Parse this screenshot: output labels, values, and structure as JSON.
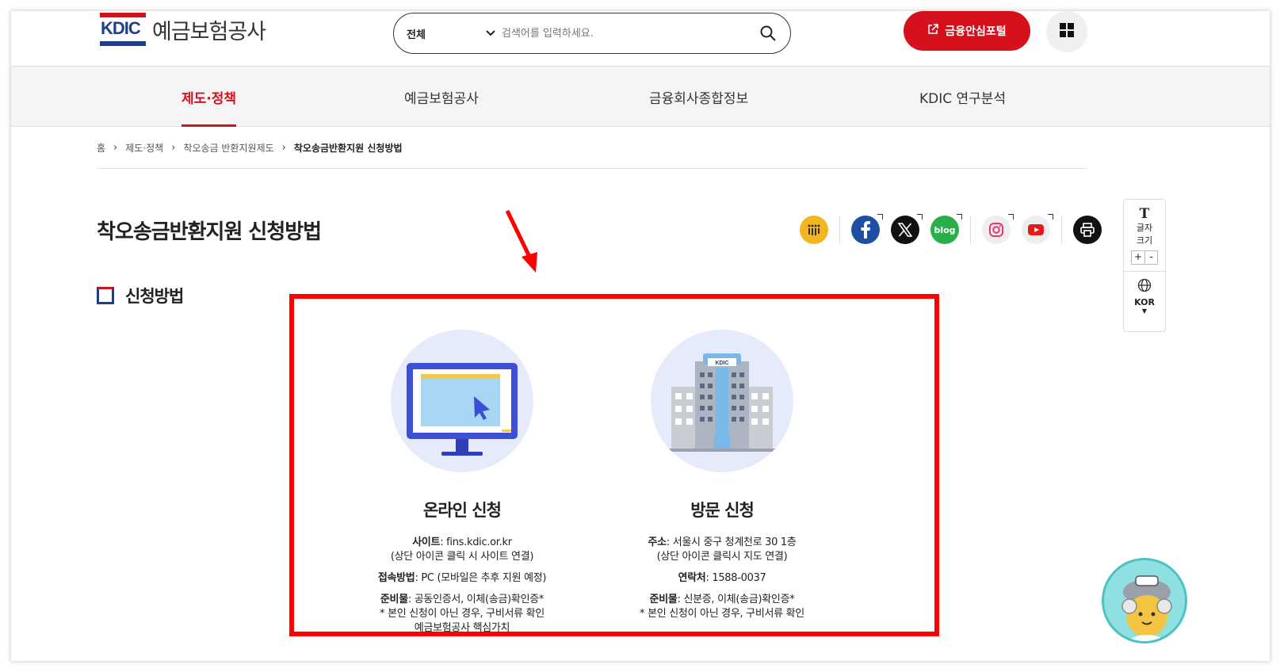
{
  "header": {
    "logo_mark": "KDIC",
    "logo_name": "예금보험공사",
    "search_category": "전체",
    "search_placeholder": "검색어를 입력하세요.",
    "portal_label": "금융안심포털"
  },
  "nav": {
    "items": [
      {
        "label": "제도·정책",
        "active": true
      },
      {
        "label": "예금보험공사",
        "active": false
      },
      {
        "label": "금융회사종합정보",
        "active": false
      },
      {
        "label": "KDIC 연구분석",
        "active": false
      }
    ]
  },
  "breadcrumb": [
    "홈",
    "제도·정책",
    "착오송금 반환지원제도",
    "착오송금반환지원 신청방법"
  ],
  "page_title": "착오송금반환지원 신청방법",
  "sns": {
    "blog_label": "blog"
  },
  "side_tool": {
    "font_icon": "T",
    "font_label_1": "글자",
    "font_label_2": "크기",
    "plus": "+",
    "minus": "-",
    "lang": "KOR"
  },
  "section_title": "신청방법",
  "online": {
    "title": "온라인 신청",
    "site_label": "사이트",
    "site_value": ": fins.kdic.or.kr",
    "site_note": "(상단 아이콘 클릭 시 사이트 연결)",
    "access_label": "접속방법",
    "access_value": ": PC (모바일은 추후 지원 예정)",
    "docs_label": "준비물",
    "docs_value": ": 공동인증서, 이체(송금)확인증*",
    "docs_note": "* 본인 신청이 아닌 경우, 구비서류 확인",
    "core_value": "예금보험공사 핵심가치"
  },
  "visit": {
    "title": "방문 신청",
    "address_label": "주소",
    "address_value": ": 서울시 중구 청계천로 30 1층",
    "address_note": "(상단 아이콘 클릭시 지도 연결)",
    "contact_label": "연락처",
    "contact_value": ": 1588-0037",
    "docs_label": "준비물",
    "docs_value": ": 신분증, 이체(송금)확인증*",
    "docs_note": "* 본인 신청이 아닌 경우, 구비서류 확인",
    "building_sign": "KDIC"
  },
  "colors": {
    "brand_red": "#d6111e",
    "brand_navy": "#1e3f8a",
    "highlight": "#ff0000"
  }
}
